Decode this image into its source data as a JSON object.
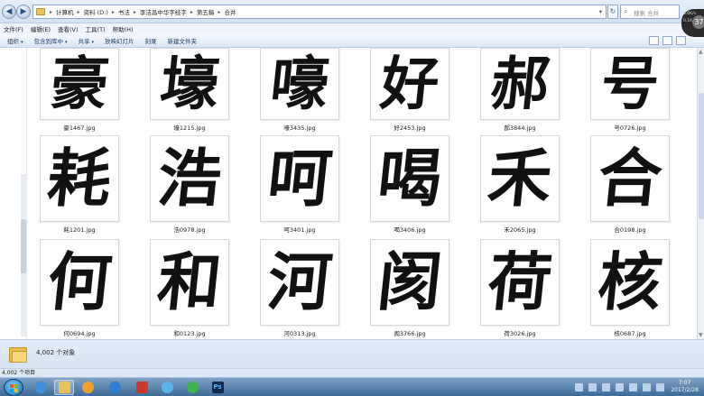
{
  "address": {
    "crumbs": [
      "计算机",
      "资料 (D:)",
      "书法",
      "李洁昌中华字经字",
      "第五稿",
      "合并"
    ],
    "search_placeholder": "搜索 合并"
  },
  "speed": {
    "up": "5.6K/s",
    "down": "0.1K/s",
    "percent": "37"
  },
  "menu": [
    "文件(F)",
    "编辑(E)",
    "查看(V)",
    "工具(T)",
    "帮助(H)"
  ],
  "commands": [
    "组织",
    "包含到库中",
    "共享",
    "放映幻灯片",
    "刻录",
    "新建文件夹"
  ],
  "files": [
    {
      "char": "豪",
      "name": "豪1467.jpg"
    },
    {
      "char": "壕",
      "name": "壕1215.jpg"
    },
    {
      "char": "嚎",
      "name": "嚎3435.jpg"
    },
    {
      "char": "好",
      "name": "好2453.jpg"
    },
    {
      "char": "郝",
      "name": "郝3844.jpg"
    },
    {
      "char": "号",
      "name": "号0726.jpg"
    },
    {
      "char": "耗",
      "name": "耗1201.jpg"
    },
    {
      "char": "浩",
      "name": "浩0978.jpg"
    },
    {
      "char": "呵",
      "name": "呵3401.jpg"
    },
    {
      "char": "喝",
      "name": "喝3406.jpg"
    },
    {
      "char": "禾",
      "name": "禾2065.jpg"
    },
    {
      "char": "合",
      "name": "合0198.jpg"
    },
    {
      "char": "何",
      "name": "何0694.jpg"
    },
    {
      "char": "和",
      "name": "和0123.jpg"
    },
    {
      "char": "河",
      "name": "河0313.jpg"
    },
    {
      "char": "阂",
      "name": "阂3766.jpg"
    },
    {
      "char": "荷",
      "name": "荷3026.jpg"
    },
    {
      "char": "核",
      "name": "核0687.jpg"
    }
  ],
  "details": {
    "count_text": "4,002 个对象"
  },
  "status": {
    "items_text": "4,002 个项目"
  },
  "taskbar": {
    "apps": [
      "windows-explorer-icon",
      "file-manager-icon",
      "media-player-icon",
      "ie-browser-icon",
      "chinese-app-icon",
      "music-player-icon",
      "play-icon",
      "photoshop-icon"
    ],
    "ps_label": "Ps",
    "time": "7:07",
    "date": "2017/2/28"
  }
}
